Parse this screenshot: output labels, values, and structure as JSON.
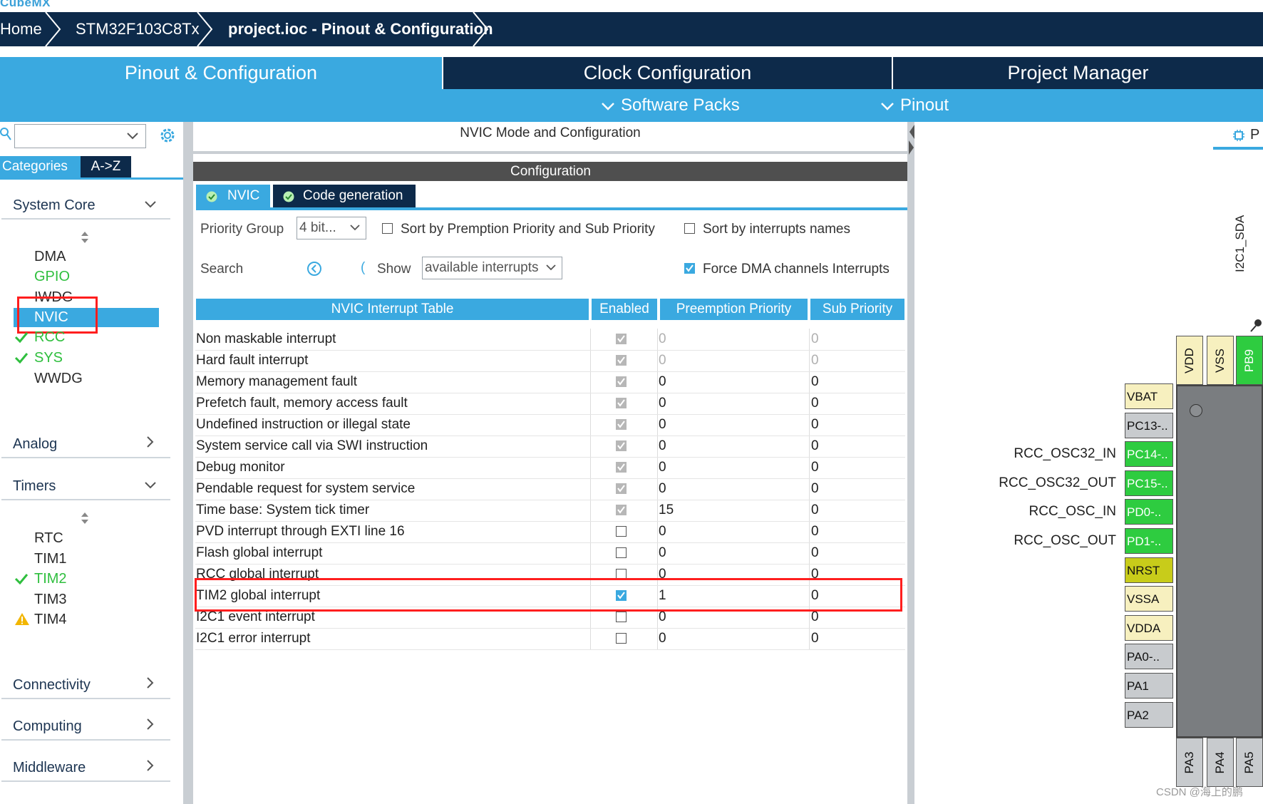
{
  "header": {
    "logo": "CubeMX",
    "breadcrumbs": [
      "Home",
      "STM32F103C8Tx",
      "project.ioc - Pinout & Configuration"
    ]
  },
  "main_tabs": [
    "Pinout & Configuration",
    "Clock Configuration",
    "Project Manager"
  ],
  "sub_menu": [
    "Software Packs",
    "Pinout"
  ],
  "left": {
    "category_tabs": [
      "Categories",
      "A->Z"
    ],
    "search_value": "",
    "system_core": {
      "label": "System Core",
      "items": [
        {
          "label": "DMA",
          "state": "none"
        },
        {
          "label": "GPIO",
          "state": "green"
        },
        {
          "label": "IWDG",
          "state": "none"
        },
        {
          "label": "NVIC",
          "state": "selected"
        },
        {
          "label": "RCC",
          "state": "checked"
        },
        {
          "label": "SYS",
          "state": "checked"
        },
        {
          "label": "WWDG",
          "state": "none"
        }
      ]
    },
    "analog": "Analog",
    "timers": {
      "label": "Timers",
      "items": [
        {
          "label": "RTC",
          "state": "none"
        },
        {
          "label": "TIM1",
          "state": "none"
        },
        {
          "label": "TIM2",
          "state": "checked"
        },
        {
          "label": "TIM3",
          "state": "none"
        },
        {
          "label": "TIM4",
          "state": "warning"
        }
      ]
    },
    "more_categories": [
      "Connectivity",
      "Computing",
      "Middleware"
    ]
  },
  "center": {
    "title": "NVIC Mode and Configuration",
    "config_header": "Configuration",
    "tabs": [
      "NVIC",
      "Code generation"
    ],
    "priority_group_label": "Priority Group",
    "priority_group_value": "4 bit...",
    "sort_preemption_label": "Sort by Premption Priority and Sub Priority",
    "sort_names_label": "Sort by interrupts names",
    "search_label": "Search",
    "show_label": "Show",
    "show_value": "available interrupts",
    "force_dma_label": "Force DMA channels Interrupts",
    "force_dma_checked": true,
    "table": {
      "headers": [
        "NVIC Interrupt Table",
        "Enabled",
        "Preemption Priority",
        "Sub Priority"
      ],
      "rows": [
        {
          "name": "Non maskable interrupt",
          "enabled": "disabled-checked",
          "pre": "0",
          "sub": "0",
          "dim": true
        },
        {
          "name": "Hard fault interrupt",
          "enabled": "disabled-checked",
          "pre": "0",
          "sub": "0",
          "dim": true
        },
        {
          "name": "Memory management fault",
          "enabled": "disabled-checked",
          "pre": "0",
          "sub": "0",
          "dim": false
        },
        {
          "name": "Prefetch fault, memory access fault",
          "enabled": "disabled-checked",
          "pre": "0",
          "sub": "0",
          "dim": false
        },
        {
          "name": "Undefined instruction or illegal state",
          "enabled": "disabled-checked",
          "pre": "0",
          "sub": "0",
          "dim": false
        },
        {
          "name": "System service call via SWI instruction",
          "enabled": "disabled-checked",
          "pre": "0",
          "sub": "0",
          "dim": false
        },
        {
          "name": "Debug monitor",
          "enabled": "disabled-checked",
          "pre": "0",
          "sub": "0",
          "dim": false
        },
        {
          "name": "Pendable request for system service",
          "enabled": "disabled-checked",
          "pre": "0",
          "sub": "0",
          "dim": false
        },
        {
          "name": "Time base: System tick timer",
          "enabled": "disabled-checked",
          "pre": "15",
          "sub": "0",
          "dim": false
        },
        {
          "name": "PVD interrupt through EXTI line 16",
          "enabled": "unchecked",
          "pre": "0",
          "sub": "0",
          "dim": false
        },
        {
          "name": "Flash global interrupt",
          "enabled": "unchecked",
          "pre": "0",
          "sub": "0",
          "dim": false
        },
        {
          "name": "RCC global interrupt",
          "enabled": "unchecked",
          "pre": "0",
          "sub": "0",
          "dim": false
        },
        {
          "name": "TIM2 global interrupt",
          "enabled": "checked",
          "pre": "1",
          "sub": "0",
          "dim": false
        },
        {
          "name": "I2C1 event interrupt",
          "enabled": "unchecked",
          "pre": "0",
          "sub": "0",
          "dim": false
        },
        {
          "name": "I2C1 error interrupt",
          "enabled": "unchecked",
          "pre": "0",
          "sub": "0",
          "dim": false
        }
      ]
    }
  },
  "right": {
    "tab_label": "P",
    "top_pins": [
      "VDD",
      "VSS",
      "PB9"
    ],
    "top_signal": "I2C1_SDA",
    "left_pins": [
      {
        "label": "VBAT",
        "color": "yellow",
        "signal": ""
      },
      {
        "label": "PC13-..",
        "color": "gray",
        "signal": ""
      },
      {
        "label": "PC14-..",
        "color": "green",
        "signal": "RCC_OSC32_IN"
      },
      {
        "label": "PC15-..",
        "color": "green",
        "signal": "RCC_OSC32_OUT"
      },
      {
        "label": "PD0-..",
        "color": "green",
        "signal": "RCC_OSC_IN"
      },
      {
        "label": "PD1-..",
        "color": "green",
        "signal": "RCC_OSC_OUT"
      },
      {
        "label": "NRST",
        "color": "olive",
        "signal": ""
      },
      {
        "label": "VSSA",
        "color": "yellow",
        "signal": ""
      },
      {
        "label": "VDDA",
        "color": "yellow",
        "signal": ""
      },
      {
        "label": "PA0-..",
        "color": "gray",
        "signal": ""
      },
      {
        "label": "PA1",
        "color": "gray",
        "signal": ""
      },
      {
        "label": "PA2",
        "color": "gray",
        "signal": ""
      }
    ],
    "bottom_pins": [
      "PA3",
      "PA4",
      "PA5"
    ]
  },
  "watermark": "CSDN @海上的鹏",
  "colors": {
    "navy": "#0d2a4a",
    "accent": "#3aa9e0",
    "green": "#2ecc40",
    "red_highlight": "#ff1e1e"
  }
}
